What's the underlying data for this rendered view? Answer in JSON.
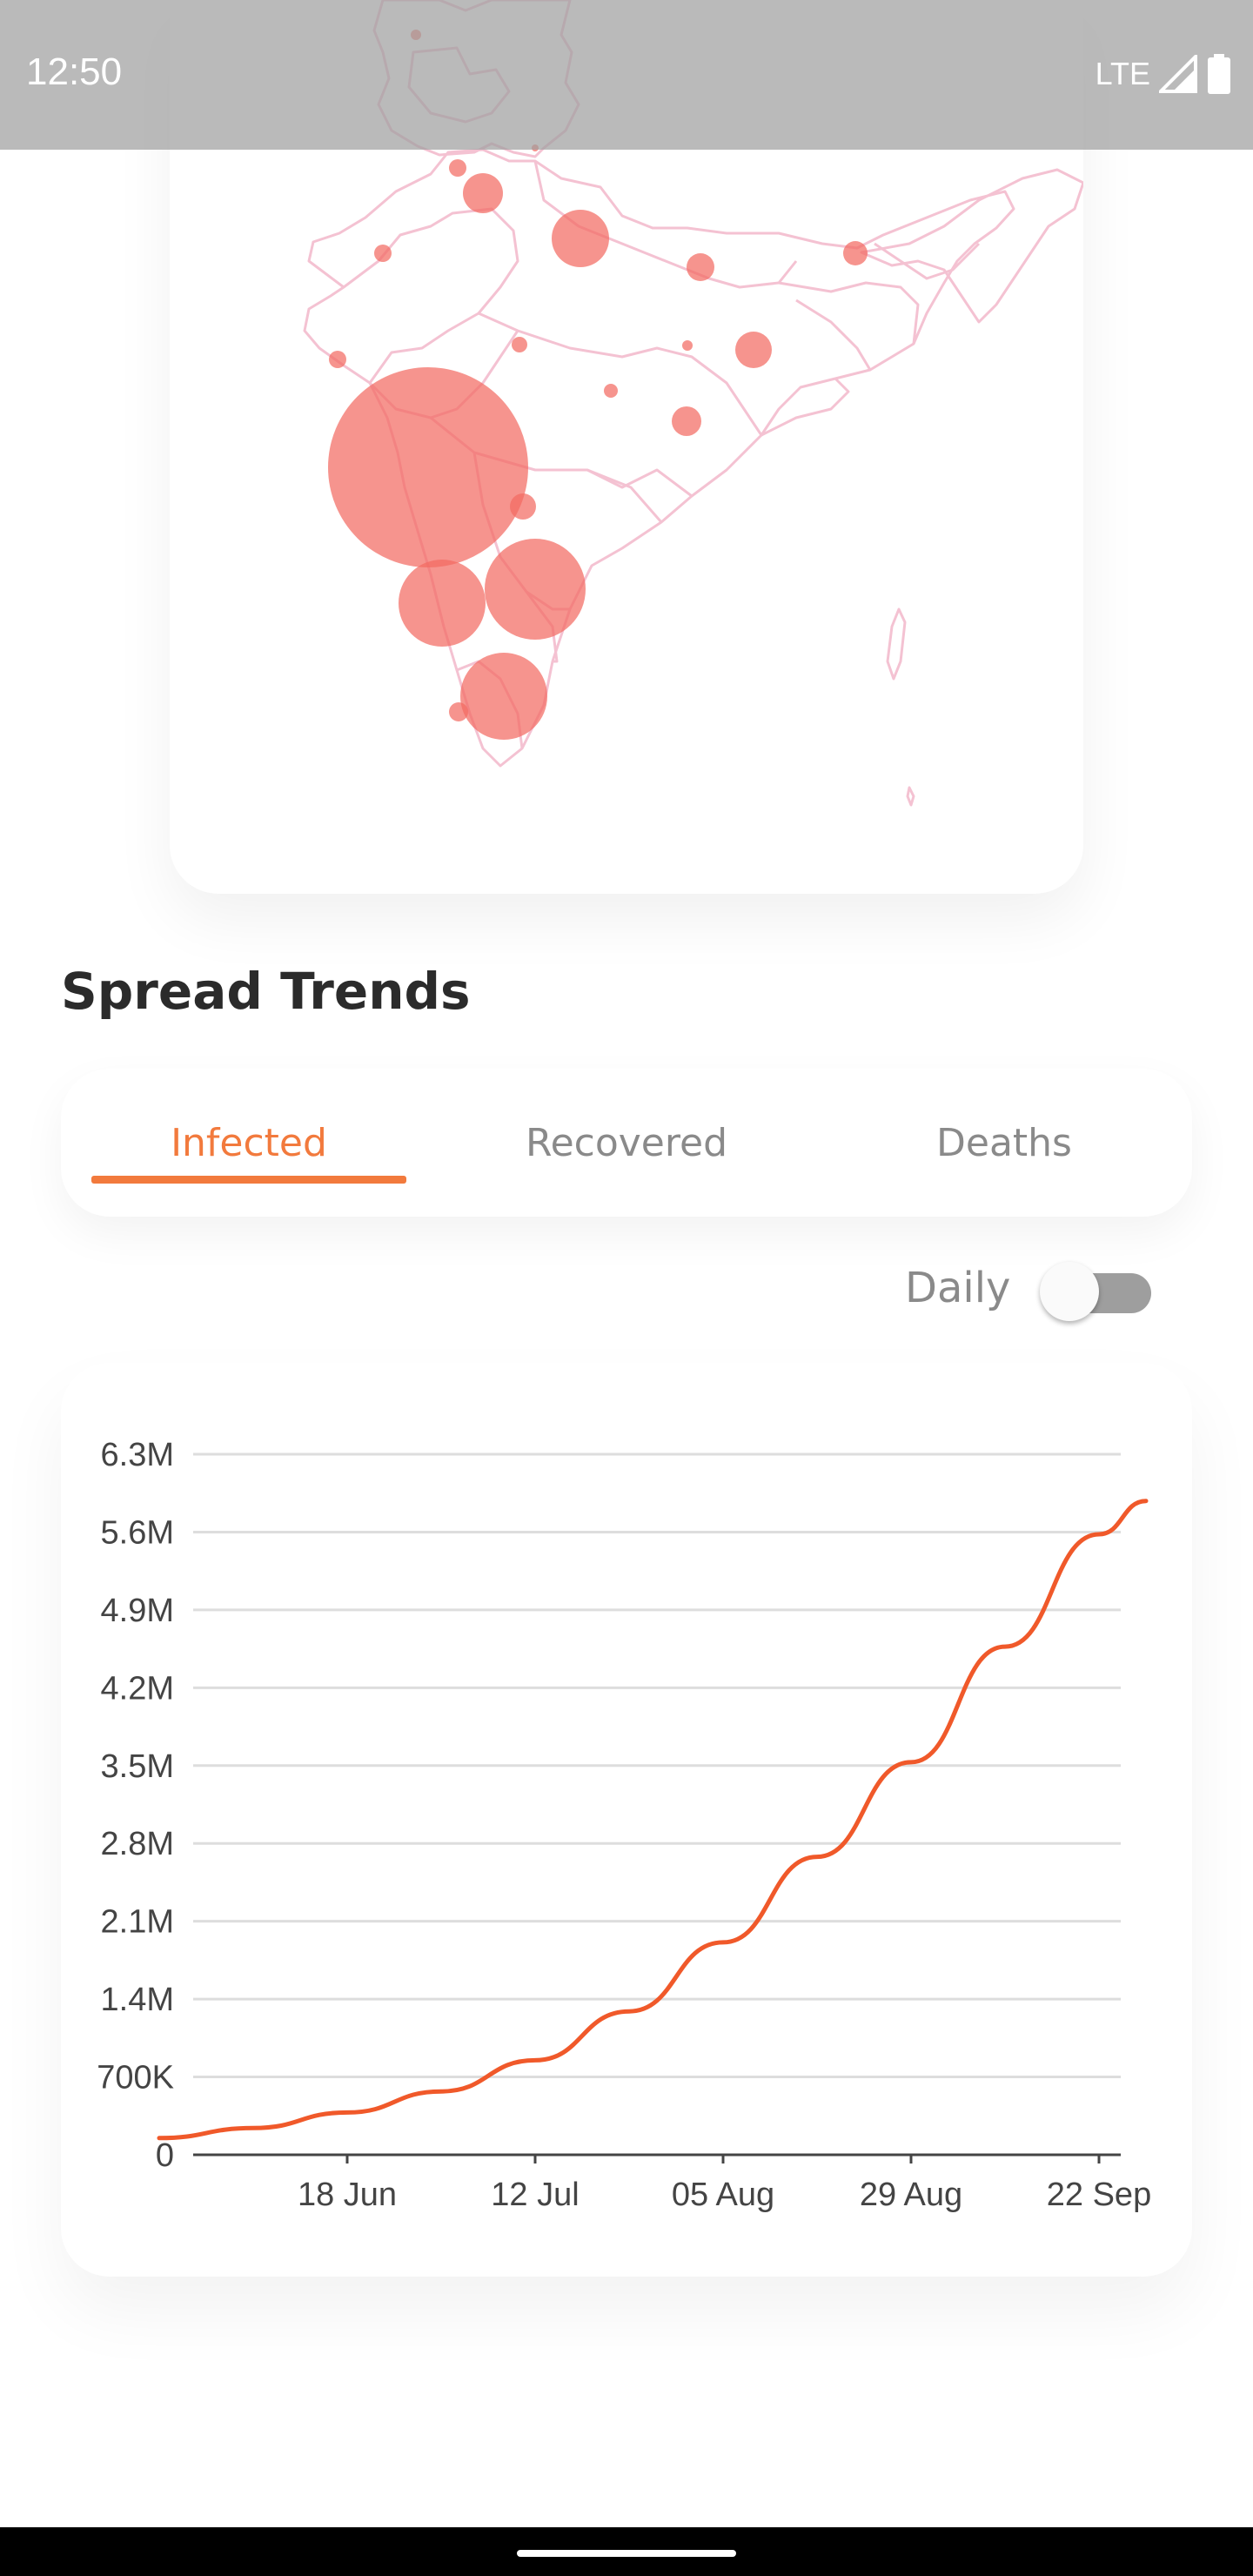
{
  "status_bar": {
    "time": "12:50",
    "network": "LTE"
  },
  "map": {
    "bubble_color": "#f26b63",
    "border_color": "#f4c2d2"
  },
  "section": {
    "title": "Spread Trends"
  },
  "tabs": [
    {
      "label": "Infected",
      "active": true
    },
    {
      "label": "Recovered",
      "active": false
    },
    {
      "label": "Deaths",
      "active": false
    }
  ],
  "toggle": {
    "label": "Daily",
    "on": false
  },
  "colors": {
    "accent": "#f27a3d",
    "line": "#f0592a"
  },
  "chart_data": {
    "type": "line",
    "title": "",
    "xlabel": "",
    "ylabel": "",
    "y_ticks": [
      "0",
      "700K",
      "1.4M",
      "2.1M",
      "2.8M",
      "3.5M",
      "4.2M",
      "4.9M",
      "5.6M",
      "6.3M"
    ],
    "x_ticks": [
      "18 Jun",
      "12 Jul",
      "05 Aug",
      "29 Aug",
      "22 Sep"
    ],
    "ylim": [
      0,
      6300000
    ],
    "grid": true,
    "series": [
      {
        "color": "#f0592a",
        "points": [
          [
            "2020-05-25",
            150000
          ],
          [
            "2020-06-06",
            240000
          ],
          [
            "2020-06-18",
            380000
          ],
          [
            "2020-06-30",
            570000
          ],
          [
            "2020-07-12",
            850000
          ],
          [
            "2020-07-24",
            1290000
          ],
          [
            "2020-08-05",
            1910000
          ],
          [
            "2020-08-17",
            2680000
          ],
          [
            "2020-08-29",
            3530000
          ],
          [
            "2020-09-10",
            4570000
          ],
          [
            "2020-09-22",
            5580000
          ],
          [
            "2020-09-28",
            5880000
          ]
        ]
      }
    ]
  }
}
